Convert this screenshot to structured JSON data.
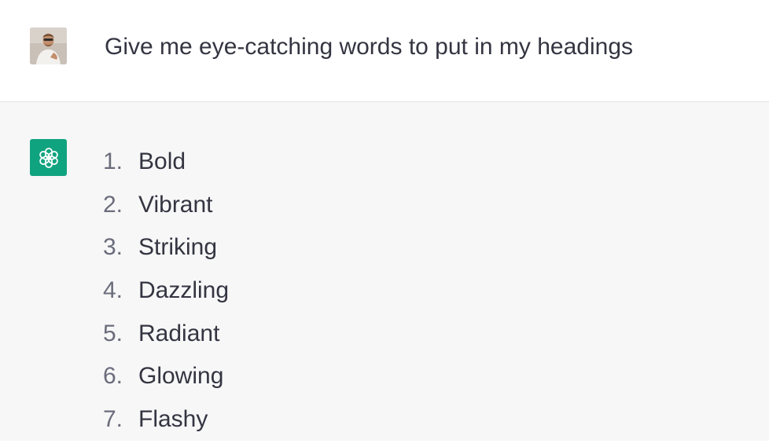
{
  "conversation": {
    "user_message": "Give me eye-catching words to put in my headings",
    "assistant_items": [
      {
        "number": "1.",
        "text": "Bold"
      },
      {
        "number": "2.",
        "text": "Vibrant"
      },
      {
        "number": "3.",
        "text": "Striking"
      },
      {
        "number": "4.",
        "text": "Dazzling"
      },
      {
        "number": "5.",
        "text": "Radiant"
      },
      {
        "number": "6.",
        "text": "Glowing"
      },
      {
        "number": "7.",
        "text": "Flashy"
      }
    ]
  },
  "icons": {
    "user_avatar": "user-photo-avatar",
    "assistant_avatar": "openai-logo-icon"
  },
  "colors": {
    "assistant_bg": "#f7f7f8",
    "assistant_avatar_bg": "#10a37f",
    "text": "#343541",
    "list_number": "#6b6c7b"
  }
}
